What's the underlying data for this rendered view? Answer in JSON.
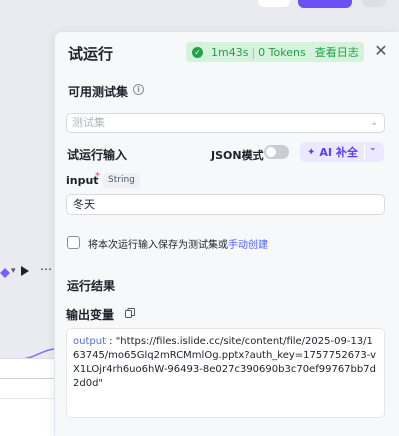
{
  "panel": {
    "title": "试运行",
    "status": {
      "duration": "1m43s",
      "separator": "|",
      "tokens": "0 Tokens",
      "log_link": "查看日志",
      "color": "#23a048"
    },
    "close_icon": "close-icon"
  },
  "test_set": {
    "label": "可用测试集",
    "info_icon": "i",
    "select_placeholder": "测试集"
  },
  "run_input": {
    "label": "试运行输入",
    "json_mode_label": "JSON模式",
    "json_mode_on": false,
    "ai_button_label": "AI 补全",
    "accent_color": "#5b3ff5"
  },
  "field": {
    "name": "input",
    "required_mark": "*",
    "type": "String",
    "value": "冬天"
  },
  "save_option": {
    "text": "将本次运行输入保存为测试集或",
    "link": "手动创建",
    "checked": false
  },
  "result": {
    "section_label": "运行结果",
    "output_label": "输出变量",
    "output_key": "output",
    "output_value": " : \"https://files.islide.cc/site/content/file/2025-09-13/163745/mo65Glq2mRCMmlOg.pptx?auth_key=1757752673-vX1LOjr4rh6uo6hW-96493-8e027c390690b3c70ef99767bb7d2d0d\""
  }
}
